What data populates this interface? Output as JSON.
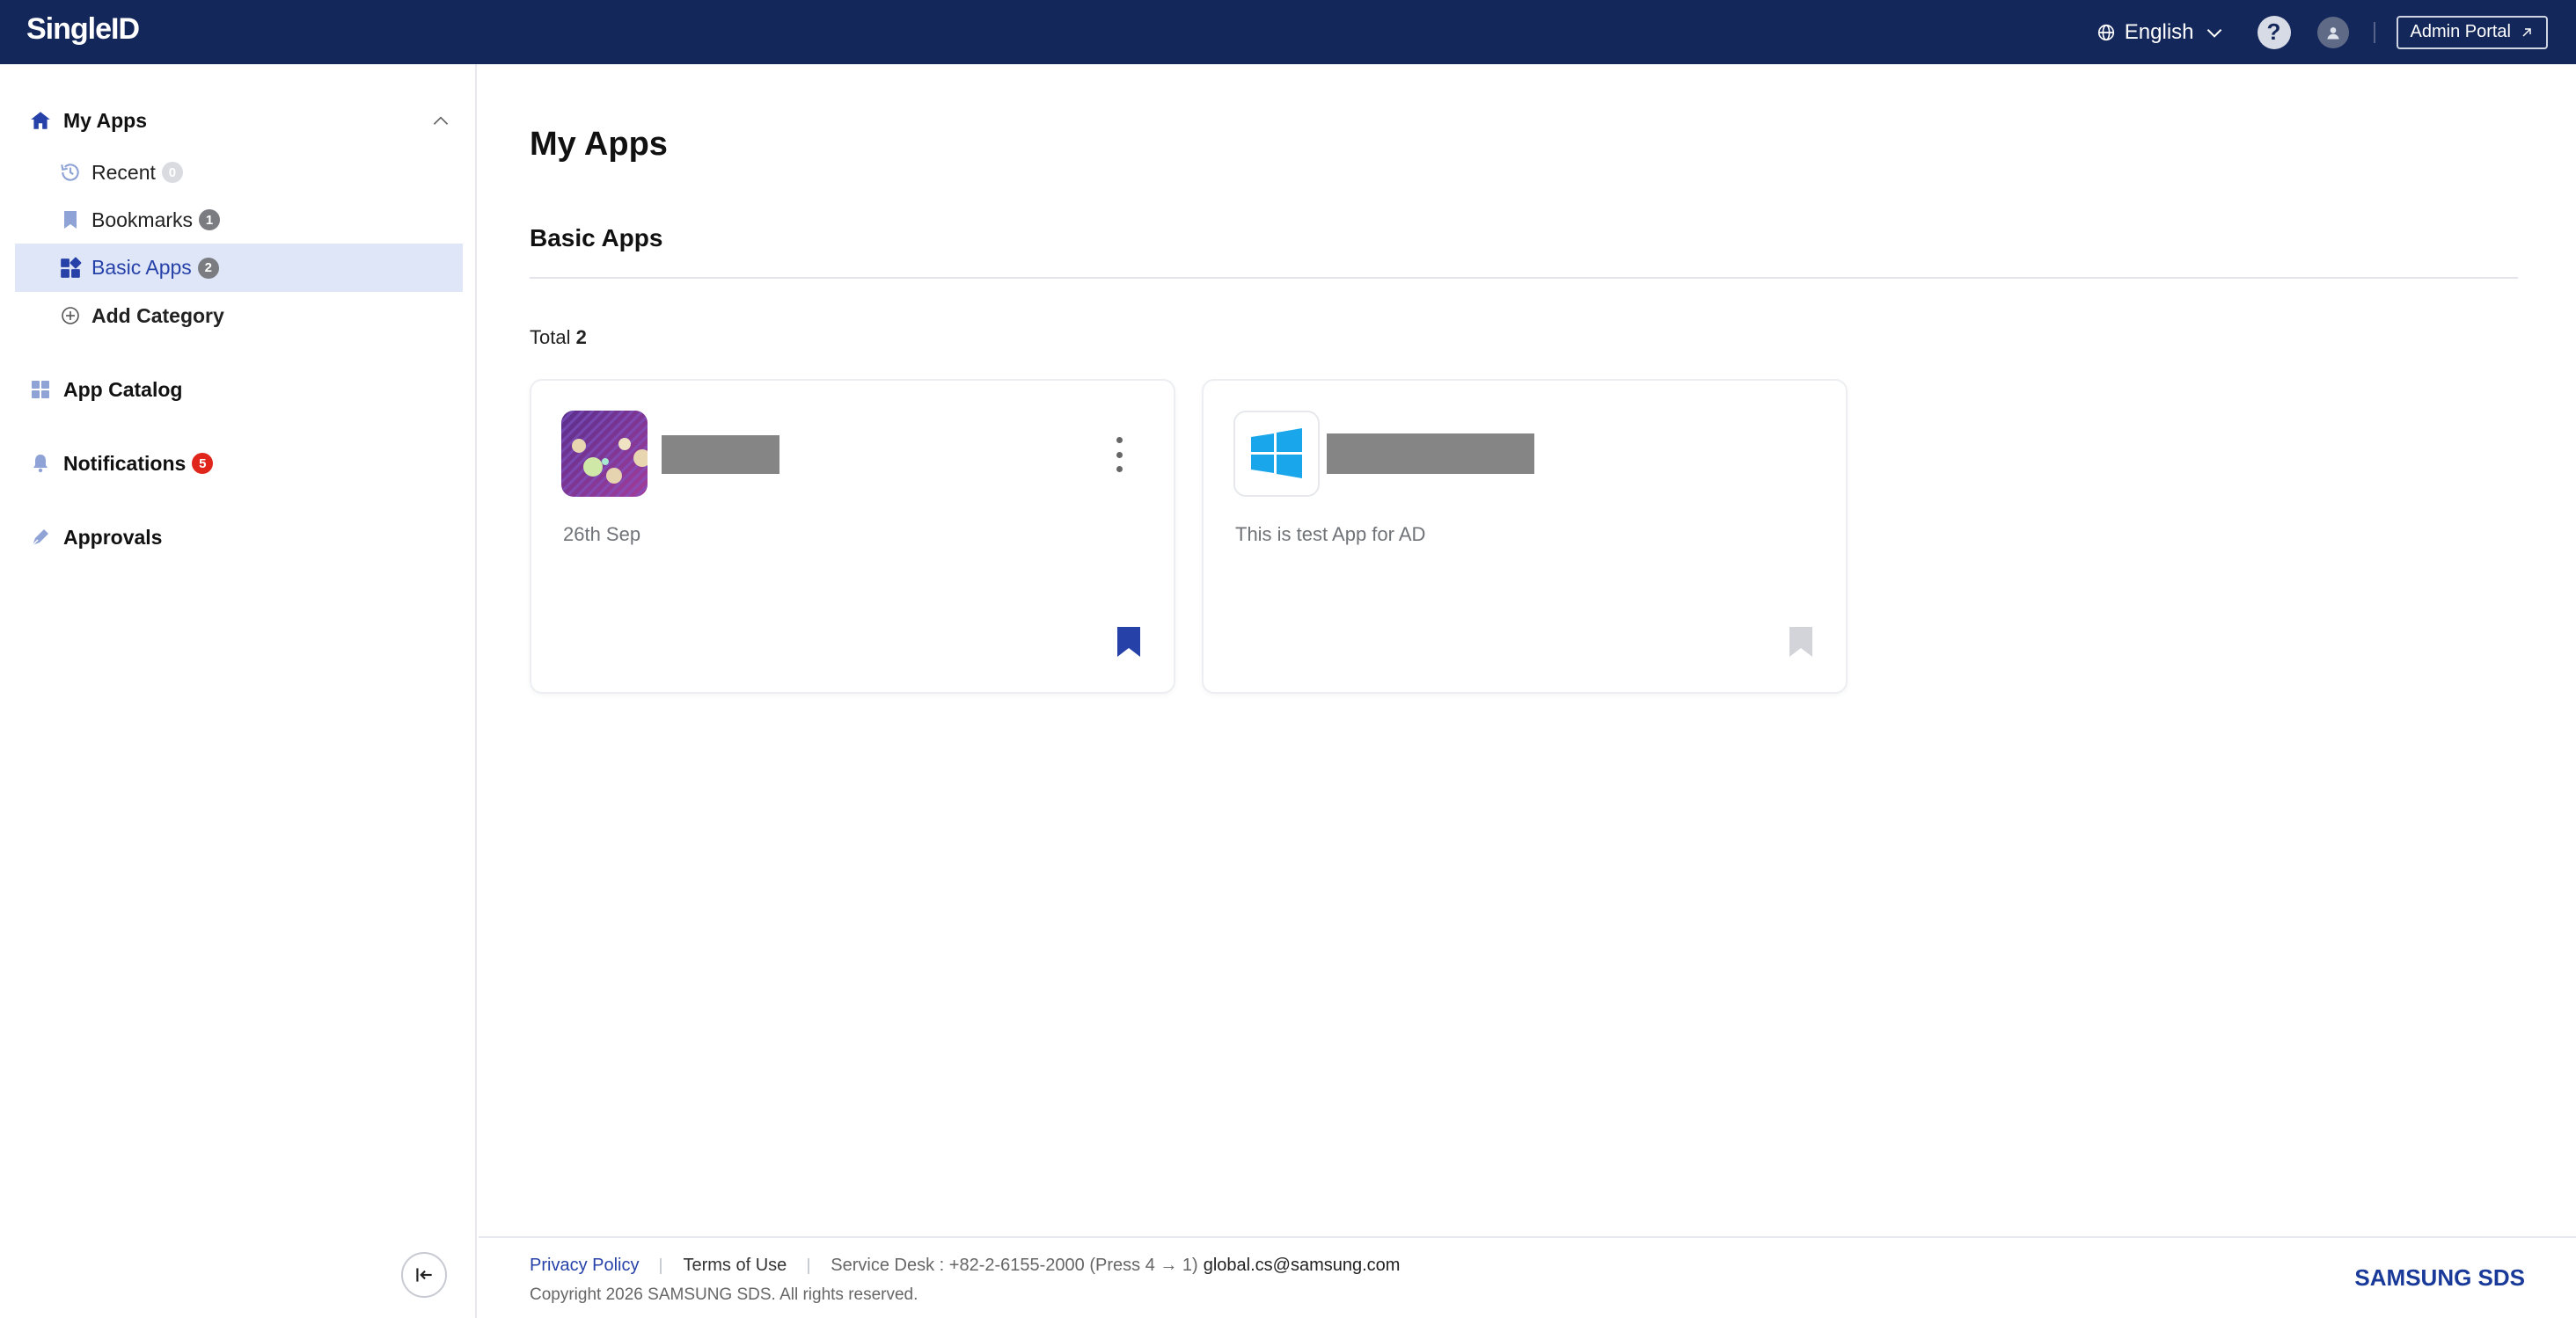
{
  "header": {
    "logo": "SingleID",
    "language": "English",
    "help_symbol": "?",
    "admin_portal": "Admin Portal"
  },
  "sidebar": {
    "my_apps": {
      "label": "My Apps",
      "icon": "home-icon"
    },
    "sub_items": [
      {
        "label": "Recent",
        "count": "0",
        "icon": "history-icon"
      },
      {
        "label": "Bookmarks",
        "count": "1",
        "icon": "bookmark-icon"
      },
      {
        "label": "Basic Apps",
        "count": "2",
        "icon": "apps-grid-icon",
        "active": true
      },
      {
        "label": "Add Category",
        "icon": "plus-circle-icon"
      }
    ],
    "app_catalog": {
      "label": "App Catalog",
      "icon": "catalog-grid-icon"
    },
    "notifications": {
      "label": "Notifications",
      "count": "5",
      "icon": "bell-icon"
    },
    "approvals": {
      "label": "Approvals",
      "icon": "pen-icon"
    }
  },
  "main": {
    "title": "My Apps",
    "section_title": "Basic Apps",
    "total_label": "Total",
    "total_count": "2",
    "apps": [
      {
        "description": "26th Sep",
        "icon": "abstract-art-icon",
        "bookmarked": true,
        "has_menu": true
      },
      {
        "description": "This is test App for AD",
        "icon": "windows-logo-icon",
        "bookmarked": false,
        "has_menu": false
      }
    ]
  },
  "footer": {
    "privacy": "Privacy Policy",
    "terms": "Terms of Use",
    "service_desk": "Service Desk : +82-2-6155-2000 (Press 4 → 1)",
    "email": "global.cs@samsung.com",
    "copyright": "Copyright 2026 SAMSUNG SDS. All rights reserved.",
    "brand": "SAMSUNG SDS"
  },
  "colors": {
    "header_bg": "#14275a",
    "accent": "#2641a8",
    "active_bg": "#dfe6f8",
    "badge_red": "#e0251b"
  }
}
